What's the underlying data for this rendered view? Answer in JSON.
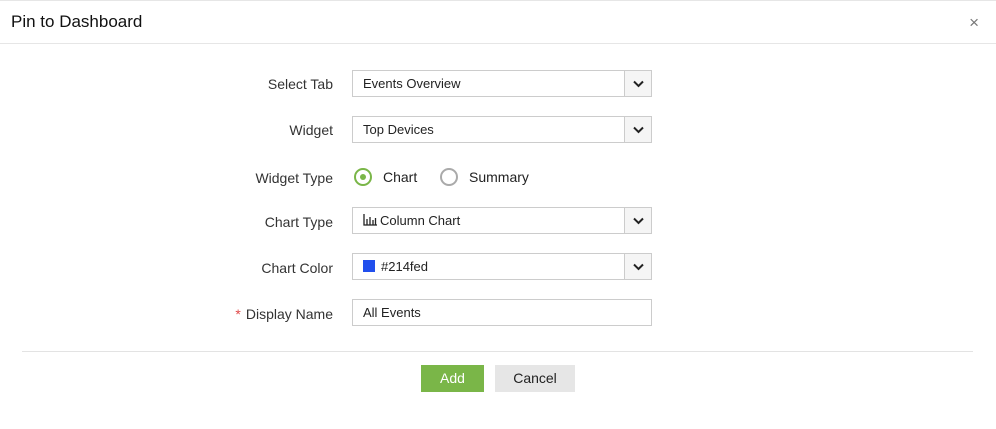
{
  "dialog": {
    "title": "Pin to Dashboard",
    "close_label": "×"
  },
  "form": {
    "select_tab": {
      "label": "Select Tab",
      "value": "Events Overview"
    },
    "widget": {
      "label": "Widget",
      "value": "Top Devices"
    },
    "widget_type": {
      "label": "Widget Type",
      "options": [
        "Chart",
        "Summary"
      ],
      "selected": "Chart"
    },
    "chart_type": {
      "label": "Chart Type",
      "value": "Column Chart",
      "icon": "column-chart-icon"
    },
    "chart_color": {
      "label": "Chart Color",
      "value": "#214fed",
      "swatch": "#214fed"
    },
    "display_name": {
      "label": "Display Name",
      "required_mark": "*",
      "value": "All Events"
    }
  },
  "buttons": {
    "add": "Add",
    "cancel": "Cancel"
  },
  "colors": {
    "accent": "#7ab648",
    "cancel_bg": "#e6e6e6"
  }
}
